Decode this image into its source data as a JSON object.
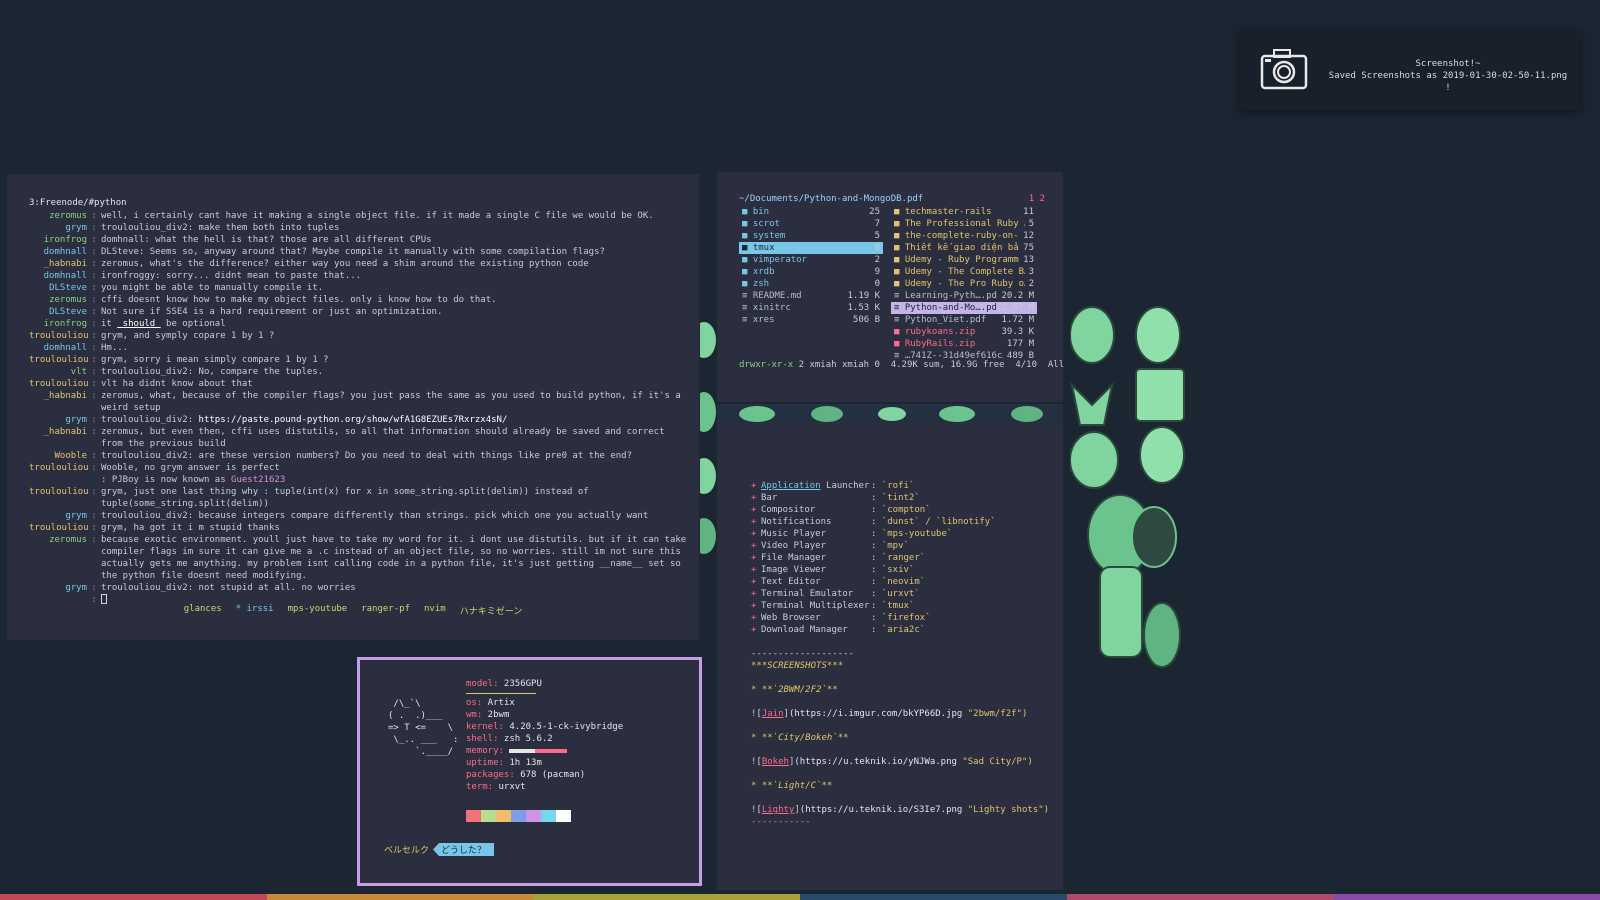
{
  "notification": {
    "title": "Screenshot!~",
    "body": "Saved Screenshots as 2019-01-30-02-50-11.png !",
    "icon": "camera-icon"
  },
  "irc": {
    "channel": "3:Freenode/#python",
    "lines": [
      {
        "nick": "zeromus",
        "c": "n-a",
        "msg": "well, i certainly cant have it making a single object file. if it made a single C file we would be OK."
      },
      {
        "nick": "grym",
        "c": "n-b",
        "msg": "troulouliou_div2: make them both into tuples"
      },
      {
        "nick": "ironfrog",
        "c": "n-a",
        "msg": "domhnall: what the hell is that? those are all different CPUs"
      },
      {
        "nick": "domhnall",
        "c": "n-b",
        "msg": "DLSteve: Seems so, anyway around that? Maybe compile it manually with some compilation flags?"
      },
      {
        "nick": "_habnabi",
        "c": "n-c",
        "msg": "zeromus, what's the difference? either way you need a shim around the existing python code"
      },
      {
        "nick": "domhnall",
        "c": "n-b",
        "msg": "ironfroggy: sorry... didnt mean to paste that..."
      },
      {
        "nick": "DLSteve",
        "c": "n-b",
        "msg": "you might be able to manually compile it."
      },
      {
        "nick": "zeromus",
        "c": "n-a",
        "msg": "cffi doesnt know how to make my object files. only i know how to do that."
      },
      {
        "nick": "DLSteve",
        "c": "n-b",
        "msg": "Not sure if SSE4 is a hard requirement or just an optimization."
      },
      {
        "nick": "ironfrog",
        "c": "n-a",
        "msg_pre": "it ",
        "msg_u": "_should_",
        "msg_post": " be optional"
      },
      {
        "nick": "troulouliou",
        "c": "n-c",
        "msg": "grym, and symply copare 1 by 1 ?"
      },
      {
        "nick": "domhnall",
        "c": "n-b",
        "msg": "Hm..."
      },
      {
        "nick": "troulouliou",
        "c": "n-c",
        "msg": "grym, sorry i mean simply compare 1 by 1 ?"
      },
      {
        "nick": "vlt",
        "c": "n-a",
        "msg": "troulouliou_div2: No, compare the tuples."
      },
      {
        "nick": "troulouliou",
        "c": "n-c",
        "msg": "vlt ha didnt know about that"
      },
      {
        "nick": "_habnabi",
        "c": "n-c",
        "msg": "zeromus, what, because of the compiler flags? you just pass the same as you used to build python, if it's a weird setup"
      },
      {
        "nick": "grym",
        "c": "n-b",
        "msg_pre": "troulouliou_div2: ",
        "msg_url": "https://paste.pound-python.org/show/wfA1G8EZUEs7Rxrzx4sN/"
      },
      {
        "nick": "_habnabi",
        "c": "n-c",
        "msg": "zeromus, but even then, cffi uses distutils, so all that information should already be saved and correct from the previous build"
      },
      {
        "nick": "Wooble",
        "c": "n-c",
        "msg": "troulouliou_div2: are these version numbers? Do you need to deal with things like pre0 at the end?"
      },
      {
        "nick": "troulouliou",
        "c": "n-c",
        "msg": "Wooble, no grym answer is perfect"
      },
      {
        "nick": "",
        "c": "n-d",
        "msg_pre": ": PJBoy is now known as ",
        "msg_guest": "Guest21623"
      },
      {
        "nick": "troulouliou",
        "c": "n-c",
        "msg": "grym, just one last thing why : tuple(int(x) for x in some_string.split(delim)) instead of tuple(some_string.split(delim))"
      },
      {
        "nick": "grym",
        "c": "n-b",
        "msg": "troulouliou_div2: because integers compare differently than strings.  pick which one you actually want"
      },
      {
        "nick": "troulouliou",
        "c": "n-c",
        "msg": "grym, ha got it  i m stupid thanks"
      },
      {
        "nick": "zeromus",
        "c": "n-a",
        "msg": "because exotic environment. youll just have to take my word for it. i dont use distutils. but if it can take compiler flags im sure it can give me a .c instead of an object file, so no worries. still im not sure this actually gets me anything. my problem isnt calling code in a python file, it's just getting __name__ set so the python file doesnt need modifying."
      },
      {
        "nick": "grym",
        "c": "n-b",
        "msg": "troulouliou_div2: not stupid at all.  no worries"
      }
    ],
    "taskbar": [
      "glances",
      "* irssi",
      "mps-youtube",
      "ranger-pf",
      "nvim",
      "ハナキミゼーン"
    ]
  },
  "ranger": {
    "path": "~/Documents/Python-and-MongoDB.pdf",
    "tabs": "1 2",
    "col1": [
      {
        "name": "bin",
        "size": "25",
        "kind": "dir"
      },
      {
        "name": "scrot",
        "size": "7",
        "kind": "dir"
      },
      {
        "name": "system",
        "size": "5",
        "kind": "dir"
      },
      {
        "name": "tmux",
        "size": "0",
        "kind": "sel"
      },
      {
        "name": "vimperator",
        "size": "2",
        "kind": "dir"
      },
      {
        "name": "xrdb",
        "size": "9",
        "kind": "dir"
      },
      {
        "name": "zsh",
        "size": "0",
        "kind": "dir"
      },
      {
        "name": "README.md",
        "size": "1.19 K",
        "kind": "pdf"
      },
      {
        "name": "xinitrc",
        "size": "1.53 K",
        "kind": "pdf"
      },
      {
        "name": "xres",
        "size": "506 B",
        "kind": "pdf"
      }
    ],
    "col2": [
      {
        "name": "techmaster-rails",
        "size": "11",
        "kind": "dir2"
      },
      {
        "name": "The Professional Ruby …",
        "size": "5",
        "kind": "dir2"
      },
      {
        "name": "the-complete-ruby-on-…",
        "size": "12",
        "kind": "dir2"
      },
      {
        "name": "Thiết kế giao diện bả…",
        "size": "75",
        "kind": "dir2"
      },
      {
        "name": "Udemy - Ruby Programm…",
        "size": "13",
        "kind": "dir2"
      },
      {
        "name": "Udemy - The Complete B…",
        "size": "3",
        "kind": "dir2"
      },
      {
        "name": "Udemy - The Pro Ruby o…",
        "size": "2",
        "kind": "dir2"
      },
      {
        "name": "Learning-Pyth….pdf",
        "size": "20.2 M",
        "kind": "pdf"
      },
      {
        "name": "Python-and-Mo….pdf",
        "size": "2.67 M",
        "kind": "sel2"
      },
      {
        "name": "Python_Viet.pdf",
        "size": "1.72 M",
        "kind": "pdf"
      },
      {
        "name": "rubykoans.zip",
        "size": "39.3 K",
        "kind": "zip"
      },
      {
        "name": "RubyRails.zip",
        "size": "177 M",
        "kind": "zip"
      },
      {
        "name": "…741Z--31d49ef616c…",
        "size": "489 B",
        "kind": "pdf"
      }
    ],
    "status_perm": "drwxr-xr-x",
    "status_rest": " 2 xmiah xmiah 0  4.29K sum, 16.9G free  4/10  All"
  },
  "markdown": {
    "apps": [
      {
        "k_pre": "",
        "k_u": "Application",
        "k_post": " Launcher",
        "v": "`rofi`"
      },
      {
        "k": "Bar",
        "v": "`tint2`"
      },
      {
        "k": "Compositor",
        "v": "`compton`"
      },
      {
        "k": "Notifications",
        "v": "`dunst` / `libnotify`"
      },
      {
        "k": "Music Player",
        "v": "`mps-youtube`"
      },
      {
        "k": "Video Player",
        "v": "`mpv`"
      },
      {
        "k": "File Manager",
        "v": "`ranger`"
      },
      {
        "k": "Image Viewer",
        "v": "`sxiv`"
      },
      {
        "k": "Text Editor",
        "v": "`neovim`"
      },
      {
        "k": "Terminal Emulator",
        "v": "`urxvt`"
      },
      {
        "k": "Terminal Multiplexer",
        "v": "`tmux`"
      },
      {
        "k": "Web Browser",
        "v": "`firefox`"
      },
      {
        "k": "Download Manager",
        "v": "`aria2c`"
      }
    ],
    "rule": "-------------------",
    "heading": "***SCREENSHOTS***",
    "shots": [
      {
        "title": "* **`2BWM/2F2`**",
        "link": "Jain",
        "url": "(https://i.imgur.com/bkYP66D.jpg ",
        "str": "\"2bwm/f2f\")"
      },
      {
        "title": "* **`City/Bokeh`**",
        "link": "Bokeh",
        "url": "(https://u.teknik.io/yNJWa.png ",
        "str": "\"Sad City/P\")"
      },
      {
        "title": "* **`Light/C`**",
        "link": "Lighty",
        "url": "(https://u.teknik.io/S3Ie7.png ",
        "str": "\"Lighty shots\")"
      }
    ],
    "endrule": "-----------"
  },
  "neofetch": {
    "model_k": "model:",
    "model_v": " 2356GPU",
    "logo": " /\\_`\\\n( .  .)___\n=> T <=    \\\n \\_.. ___   :\n     `.____/",
    "rows": [
      {
        "k": "os:",
        "v": " Artix"
      },
      {
        "k": "wm:",
        "v": " 2bwm"
      },
      {
        "k": "kernel:",
        "v": " 4.20.5-1-ck-ivybridge"
      },
      {
        "k": "shell:",
        "v": " zsh 5.6.2"
      }
    ],
    "memory_k": "memory:",
    "memory_fraction": 0.45,
    "rows2": [
      {
        "k": "uptime:",
        "v": " 1h 13m"
      },
      {
        "k": "packages:",
        "v": " 678 (pacman)"
      },
      {
        "k": "term:",
        "v": " urxvt"
      }
    ],
    "palette": [
      "#f0727c",
      "#b9dd8e",
      "#f1bd6a",
      "#7f9de8",
      "#cf94e4",
      "#78d7f0",
      "#ffffff"
    ],
    "prompt_a": "ベルセルク",
    "prompt_b": "どうした？"
  },
  "colors": {
    "background": "#1c2633",
    "window": "#2a2e3f",
    "accent_cyan": "#78c7e8",
    "accent_pink": "#ff6b8a",
    "accent_yellow": "#e0c56e",
    "accent_green": "#8ad17e",
    "neofetch_border": "#c79ce8",
    "bottom_bar": [
      "#c04858",
      "#c8883a",
      "#a8a038",
      "#2a4a6a",
      "#b04a6a",
      "#8a4aa8"
    ]
  }
}
